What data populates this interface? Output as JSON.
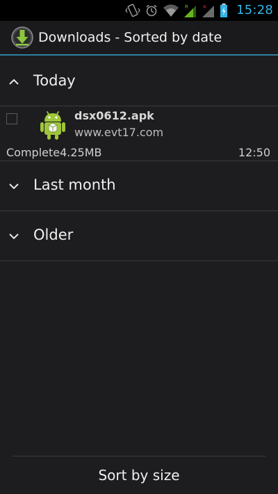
{
  "status_bar": {
    "time": "15:28",
    "icons": [
      "vibrate-icon",
      "alarm-icon",
      "wifi-icon",
      "signal-r-icon",
      "signal-x-icon",
      "battery-charging-icon"
    ]
  },
  "action_bar": {
    "title": "Downloads - Sorted by date",
    "app_icon": "download-icon"
  },
  "groups": [
    {
      "label": "Today",
      "expanded": true,
      "items": [
        {
          "name": "dsx0612.apk",
          "host": "www.evt17.com",
          "status": "Complete",
          "size": "4.25MB",
          "time": "12:50",
          "icon": "android-package-icon",
          "checked": false
        }
      ]
    },
    {
      "label": "Last month",
      "expanded": false
    },
    {
      "label": "Older",
      "expanded": false
    }
  ],
  "footer": {
    "sort_button": "Sort by size"
  },
  "colors": {
    "accent": "#33b5e5",
    "divider": "#2f7fa3",
    "android_green": "#9fc63a"
  }
}
